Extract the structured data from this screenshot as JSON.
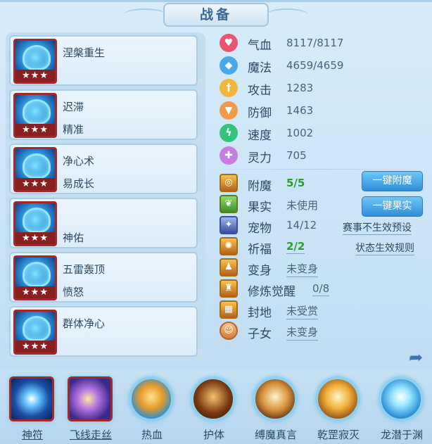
{
  "window": {
    "title": "战备"
  },
  "skills": [
    {
      "line1": "涅槃重生",
      "line2": "",
      "stars": "★★★"
    },
    {
      "line1": "迟滞",
      "line2": "精准",
      "stars": "★★★"
    },
    {
      "line1": "净心术",
      "line2": "易成长",
      "stars": "★★★"
    },
    {
      "line1": "",
      "line2": "神佑",
      "stars": "★★★"
    },
    {
      "line1": "五雷轰顶",
      "line2": "愤怒",
      "stars": "★★★"
    },
    {
      "line1": "群体净心",
      "line2": "",
      "stars": "★★★"
    }
  ],
  "stats": [
    {
      "label": "气血",
      "value": "8117/8117",
      "icon": "heart-icon",
      "color": "#e8576f",
      "glyph": "♥"
    },
    {
      "label": "魔法",
      "value": "4659/4659",
      "icon": "mana-icon",
      "color": "#4aa7ea",
      "glyph": "◆"
    },
    {
      "label": "攻击",
      "value": "1283",
      "icon": "sword-icon",
      "color": "#f2b63c",
      "glyph": "†"
    },
    {
      "label": "防御",
      "value": "1463",
      "icon": "shield-icon",
      "color": "#f19a4a",
      "glyph": "▼"
    },
    {
      "label": "速度",
      "value": "1002",
      "icon": "lightning-icon",
      "color": "#35c27a",
      "glyph": "ϟ"
    },
    {
      "label": "灵力",
      "value": "705",
      "icon": "spirit-icon",
      "color": "#c57ee0",
      "glyph": "✚"
    }
  ],
  "extras": [
    {
      "label": "附魔",
      "value": "5/5",
      "icon": "enchant-icon",
      "glyph": "◎"
    },
    {
      "label": "果实",
      "value": "未使用",
      "icon": "fruit-icon",
      "glyph": "❦"
    },
    {
      "label": "宠物",
      "value": "14/12",
      "icon": "pet-icon",
      "glyph": "✦"
    },
    {
      "label": "祈福",
      "value": "2/2",
      "icon": "blessing-icon",
      "glyph": "✺"
    },
    {
      "label": "变身",
      "value": "未变身",
      "icon": "transform-icon",
      "glyph": "♟"
    },
    {
      "label": "修炼觉醒",
      "value": "0/8",
      "icon": "awaken-icon",
      "glyph": "♜"
    },
    {
      "label": "封地",
      "value": "未受赏",
      "icon": "fief-icon",
      "glyph": "▦"
    },
    {
      "label": "子女",
      "value": "未变身",
      "icon": "child-icon",
      "glyph": "☺"
    }
  ],
  "buttons": {
    "enchant": "一键附魔",
    "fruit": "一键果实"
  },
  "links": {
    "preset": "赛事不生效预设",
    "rules": "状态生效规则"
  },
  "tabs": [
    {
      "label": "神符",
      "icon": "talisman-icon"
    },
    {
      "label": "飞线走丝",
      "icon": "silk-thread-icon"
    },
    {
      "label": "热血",
      "icon": "hot-blood-icon"
    },
    {
      "label": "护体",
      "icon": "body-guard-icon"
    },
    {
      "label": "缚魔真言",
      "icon": "bind-demon-icon"
    },
    {
      "label": "乾罡寂灭",
      "icon": "qiangang-icon"
    },
    {
      "label": "龙潜于渊",
      "icon": "dragon-icon"
    }
  ]
}
